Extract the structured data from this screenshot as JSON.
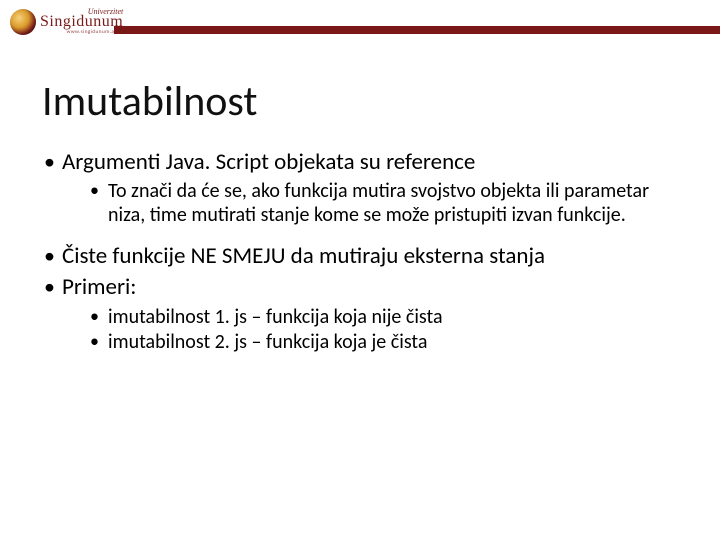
{
  "header": {
    "logo_uni": "Univerzitet",
    "logo_name": "Singidunum",
    "logo_url": "www.singidunum.ac.rs"
  },
  "slide": {
    "title": "Imutabilnost",
    "bullets": [
      {
        "text": "Argumenti Java. Script objekata su reference",
        "sub": [
          "To znači da će se, ako funkcija mutira svojstvo objekta ili parametar niza, time mutirati stanje kome se može pristupiti izvan funkcije."
        ]
      },
      {
        "text": "Čiste funkcije NE SMEJU da mutiraju eksterna stanja",
        "sub": []
      },
      {
        "text": "Primeri:",
        "sub": [
          "imutabilnost 1. js – funkcija koja nije čista",
          "imutabilnost 2. js – funkcija koja je čista"
        ]
      }
    ]
  }
}
